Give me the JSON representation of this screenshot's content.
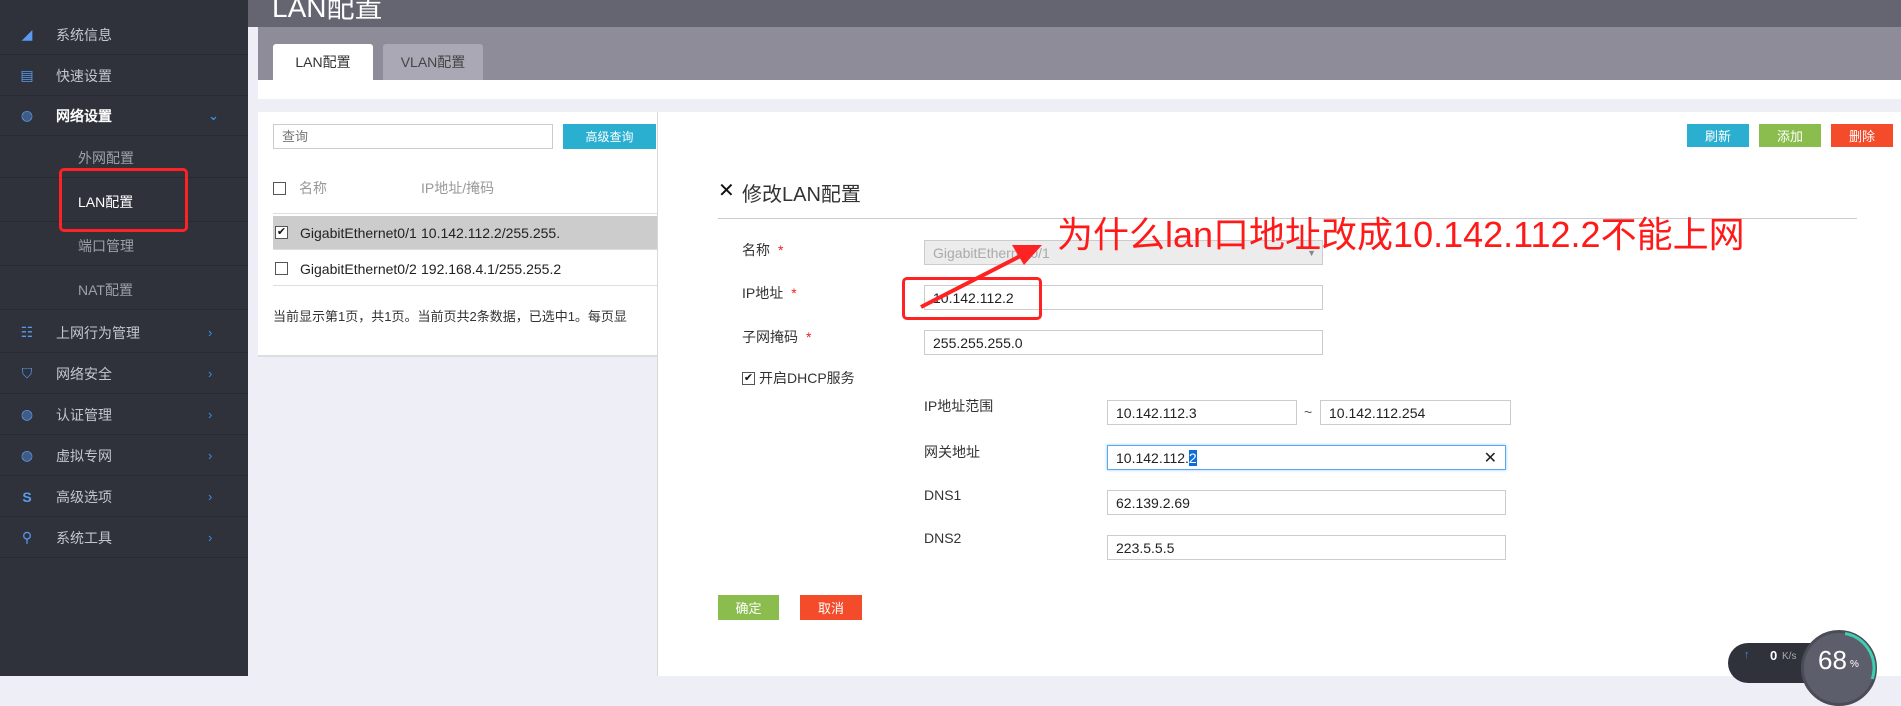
{
  "sidebar": {
    "items": [
      {
        "label": "系统信息",
        "icon": "speedometer-icon"
      },
      {
        "label": "快速设置",
        "icon": "document-wrench-icon"
      },
      {
        "label": "网络设置",
        "icon": "globe-icon",
        "expanded": true,
        "children": [
          {
            "label": "外网配置"
          },
          {
            "label": "LAN配置",
            "active": true
          },
          {
            "label": "端口管理"
          },
          {
            "label": "NAT配置"
          }
        ]
      },
      {
        "label": "上网行为管理",
        "icon": "network-tree-icon"
      },
      {
        "label": "网络安全",
        "icon": "shield-wifi-icon"
      },
      {
        "label": "认证管理",
        "icon": "globe-icon"
      },
      {
        "label": "虚拟专网",
        "icon": "globe-user-icon"
      },
      {
        "label": "高级选项",
        "icon": "s-logo-icon"
      },
      {
        "label": "系统工具",
        "icon": "tools-icon"
      }
    ]
  },
  "page": {
    "title": "LAN配置",
    "tabs": [
      {
        "label": "LAN配置",
        "active": true
      },
      {
        "label": "VLAN配置"
      }
    ]
  },
  "list": {
    "search_placeholder": "查询",
    "advanced_search": "高级查询",
    "columns": [
      "名称",
      "IP地址/掩码"
    ],
    "rows": [
      {
        "name": "GigabitEthernet0/1",
        "ip": "10.142.112.2/255.255.",
        "checked": true
      },
      {
        "name": "GigabitEthernet0/2",
        "ip": "192.168.4.1/255.255.2",
        "checked": false
      }
    ],
    "footer": "当前显示第1页，共1页。当前页共2条数据，已选中1。每页显"
  },
  "toolbar": {
    "refresh": "刷新",
    "add": "添加",
    "delete": "删除"
  },
  "dialog": {
    "title": "修改LAN配置",
    "name_label": "名称",
    "name_value": "GigabitEthernet0/1",
    "ip_label": "IP地址",
    "ip_value": "10.142.112.2",
    "mask_label": "子网掩码",
    "mask_value": "255.255.255.0",
    "dhcp_label": "开启DHCP服务",
    "dhcp_checked": true,
    "range_label": "IP地址范围",
    "range_start": "10.142.112.3",
    "range_sep": "~",
    "range_end": "10.142.112.254",
    "gateway_label": "网关地址",
    "gateway_value_prefix": "10.142.112.",
    "gateway_value_selected": "2",
    "dns1_label": "DNS1",
    "dns1_value": "62.139.2.69",
    "dns2_label": "DNS2",
    "dns2_value": "223.5.5.5",
    "ok": "确定",
    "cancel": "取消"
  },
  "annotation": {
    "text": "为什么lan口地址改成10.142.112.2不能上网",
    "color": "#ff1a1a"
  },
  "speed_widget": {
    "upload": "0",
    "unit": "K/s",
    "percent": "68",
    "percent_sign": "%",
    "percent_value": 68
  },
  "colors": {
    "sidebar": "#2f323b",
    "blue": "#2aafd0",
    "green": "#8bbd4e",
    "red": "#f44b2a"
  }
}
